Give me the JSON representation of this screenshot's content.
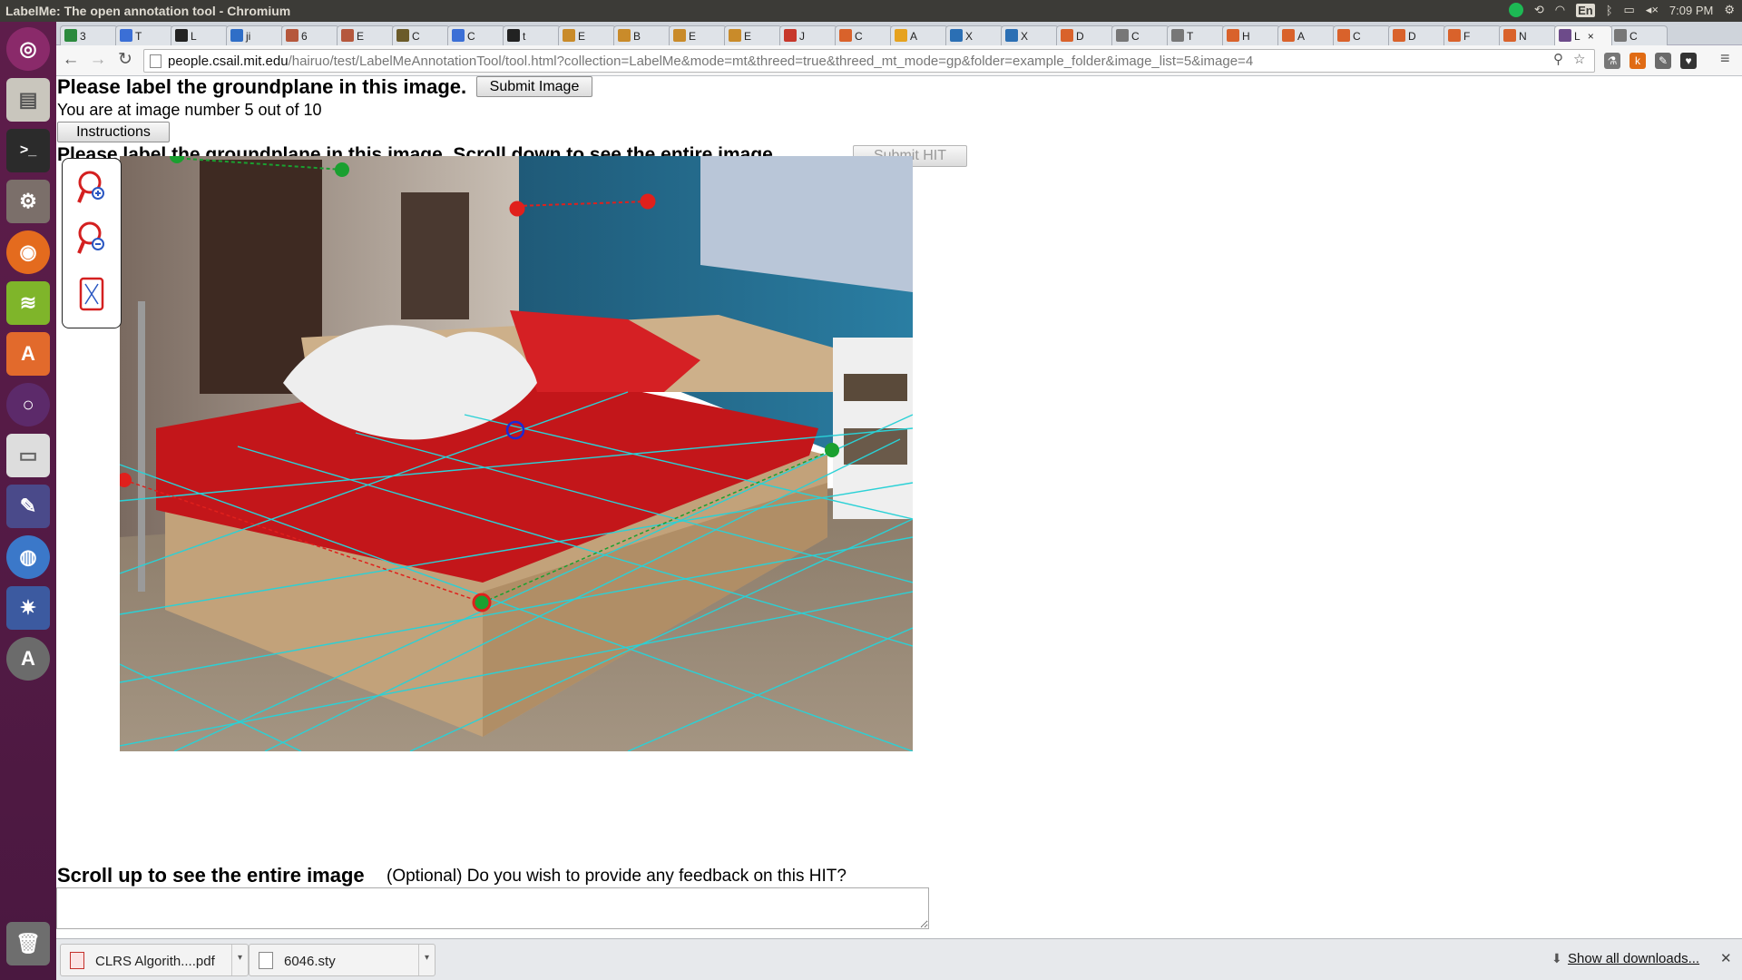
{
  "window": {
    "title": "LabelMe: The open annotation tool - Chromium",
    "clock": "7:09 PM",
    "keyboard": "En"
  },
  "tabs": [
    {
      "label": "3",
      "color": "#2b8a3e"
    },
    {
      "label": "T",
      "color": "#3b6fd6"
    },
    {
      "label": "L",
      "color": "#222"
    },
    {
      "label": "ji",
      "color": "#2f6ec7"
    },
    {
      "label": "6",
      "color": "#b5573c"
    },
    {
      "label": "E",
      "color": "#b5573c"
    },
    {
      "label": "C",
      "color": "#6b5b2a"
    },
    {
      "label": "C",
      "color": "#3b6fd6"
    },
    {
      "label": "t",
      "color": "#222"
    },
    {
      "label": "E",
      "color": "#c98b2a"
    },
    {
      "label": "B",
      "color": "#c98b2a"
    },
    {
      "label": "E",
      "color": "#c98b2a"
    },
    {
      "label": "E",
      "color": "#c98b2a"
    },
    {
      "label": "J",
      "color": "#c7372b"
    },
    {
      "label": "C",
      "color": "#d9622b"
    },
    {
      "label": "A",
      "color": "#e6a21e"
    },
    {
      "label": "X",
      "color": "#2b6fb4"
    },
    {
      "label": "X",
      "color": "#2b6fb4"
    },
    {
      "label": "D",
      "color": "#d9622b"
    },
    {
      "label": "C",
      "color": "#777"
    },
    {
      "label": "T",
      "color": "#777"
    },
    {
      "label": "H",
      "color": "#d9622b"
    },
    {
      "label": "A",
      "color": "#d9622b"
    },
    {
      "label": "C",
      "color": "#d9622b"
    },
    {
      "label": "D",
      "color": "#d9622b"
    },
    {
      "label": "F",
      "color": "#d9622b"
    },
    {
      "label": "N",
      "color": "#d9622b"
    },
    {
      "label": "L",
      "color": "#6d4b8a",
      "active": true
    },
    {
      "label": "C",
      "color": "#777"
    }
  ],
  "address": {
    "host": "people.csail.mit.edu",
    "path": "/hairuo/test/LabelMeAnnotationTool/tool.html?collection=LabelMe&mode=mt&threed=true&threed_mt_mode=gp&folder=example_folder&image_list=5&image=4"
  },
  "page": {
    "heading": "Please label the groundplane in this image.",
    "submit_image": "Submit Image",
    "progress_text": "You are at image number 5 out of 10",
    "image_number": 5,
    "image_total": 10,
    "instructions": "Instructions",
    "heading2": "Please label the groundplane in this image. Scroll down to see the entire image.",
    "submit_hit": "Submit HIT",
    "scroll_up": "Scroll up to see the entire image",
    "feedback_prompt": "(Optional) Do you wish to provide any feedback on this HIT?",
    "feedback_value": ""
  },
  "zoom_tools": [
    "zoom-in-icon",
    "zoom-out-icon",
    "fit-to-screen-icon"
  ],
  "downloads": [
    {
      "name": "CLRS Algorith....pdf",
      "icon": "pdf-icon"
    },
    {
      "name": "6046.sty",
      "icon": "file-icon"
    }
  ],
  "show_all_downloads": "Show all downloads...",
  "colors": {
    "grid": "#2ad1d6",
    "red_point": "#e0201c",
    "green_point": "#1aa030",
    "blue_point": "#1a2ad8"
  }
}
